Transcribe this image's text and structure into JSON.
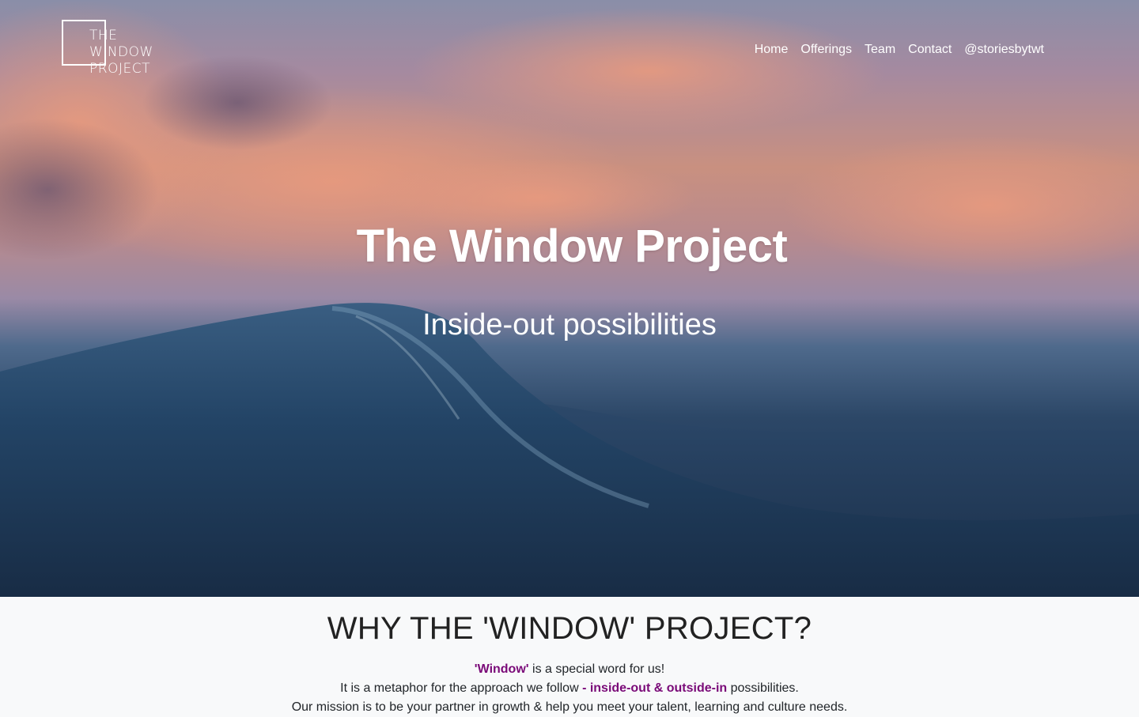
{
  "brand": {
    "logo_lines": [
      "THE",
      "WINDOW",
      "PROJECT"
    ]
  },
  "nav": {
    "items": [
      "Home",
      "Offerings",
      "Team",
      "Contact",
      "@storiesbytwt"
    ]
  },
  "hero": {
    "title": "The Window Project",
    "subtitle": "Inside-out possibilities"
  },
  "why": {
    "heading": "WHY THE 'WINDOW' PROJECT?",
    "line1": {
      "highlight": "'Window'",
      "rest": " is a special word for us!"
    },
    "line2": {
      "before": "It is a metaphor for the approach we follow ",
      "highlight": "- inside-out & outside-in",
      "after": " possibilities."
    },
    "line3": "Our mission is to be your partner in growth & help you meet your talent, learning and culture needs."
  },
  "colors": {
    "accent": "#7a0a78",
    "text": "#212529",
    "section_bg": "#f8f9fa"
  }
}
